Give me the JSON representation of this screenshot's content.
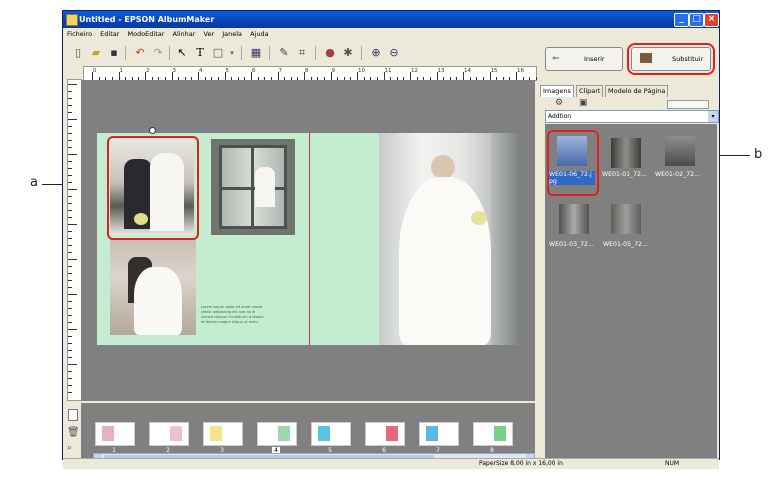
{
  "window": {
    "title": "Untitled - EPSON AlbumMaker"
  },
  "menu": [
    "Ficheiro",
    "Editar",
    "ModoEditar",
    "Alinhar",
    "Ver",
    "Janela",
    "Ajuda"
  ],
  "ruler": {
    "numbers": [
      "0",
      "1",
      "2",
      "3",
      "4",
      "5",
      "6",
      "7",
      "8",
      "9",
      "10",
      "11",
      "12",
      "13",
      "14",
      "15",
      "16"
    ]
  },
  "panel": {
    "insert_label": "Inserir",
    "replace_label": "Substituir",
    "tabs": [
      "Imagens",
      "Clipart",
      "Modelo de Página"
    ],
    "dropdown_value": "Addtion",
    "images": [
      {
        "label": "WE01-06_72.jpg",
        "selected": true
      },
      {
        "label": "WE01-01_72...",
        "selected": false
      },
      {
        "label": "WE01-02_72...",
        "selected": false
      },
      {
        "label": "WE01-03_72...",
        "selected": false
      },
      {
        "label": "WE01-05_72...",
        "selected": false
      }
    ]
  },
  "pages": [
    "1",
    "2",
    "3",
    "4",
    "5",
    "6",
    "7",
    "8"
  ],
  "status": {
    "paper_size": "PaperSize  8,00 in x 16,00 in",
    "num": "NUM"
  },
  "callouts": {
    "a": "a",
    "b": "b"
  },
  "page_text": {
    "caption_lines": [
      "Lorem ipsum dolor sit amet conse",
      "ctetur adipiscing elit sed do ei",
      "usmod tempor incididunt ut labore",
      "et dolore magna aliqua ut enim"
    ]
  }
}
